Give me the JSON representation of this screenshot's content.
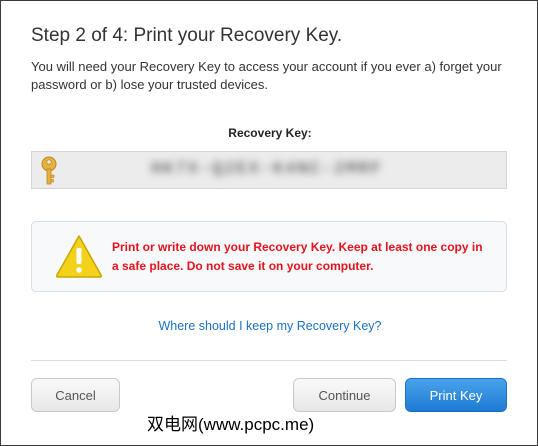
{
  "dialog": {
    "title": "Step 2 of 4: Print your Recovery Key.",
    "description": "You will need your Recovery Key to access your account if you ever a) forget your password or b) lose your trusted devices.",
    "recovery_key_label": "Recovery Key:",
    "recovery_key_value": "HK7X-Q2EX-K4NC-2MRF",
    "key_icon": "key-icon",
    "warning_icon": "warning-icon",
    "warning_text": "Print or write down your Recovery Key. Keep at least one copy in a safe place. Do not save it on your computer.",
    "help_link": "Where should I keep my Recovery Key?"
  },
  "buttons": {
    "cancel": "Cancel",
    "continue": "Continue",
    "print": "Print Key"
  },
  "watermark": "双电网(www.pcpc.me)",
  "colors": {
    "warning_text": "#e4131d",
    "link": "#1a70c4",
    "primary_button": "#1e7ad3",
    "key_gold": "#e6b23a",
    "warning_yellow": "#f2d21a"
  }
}
